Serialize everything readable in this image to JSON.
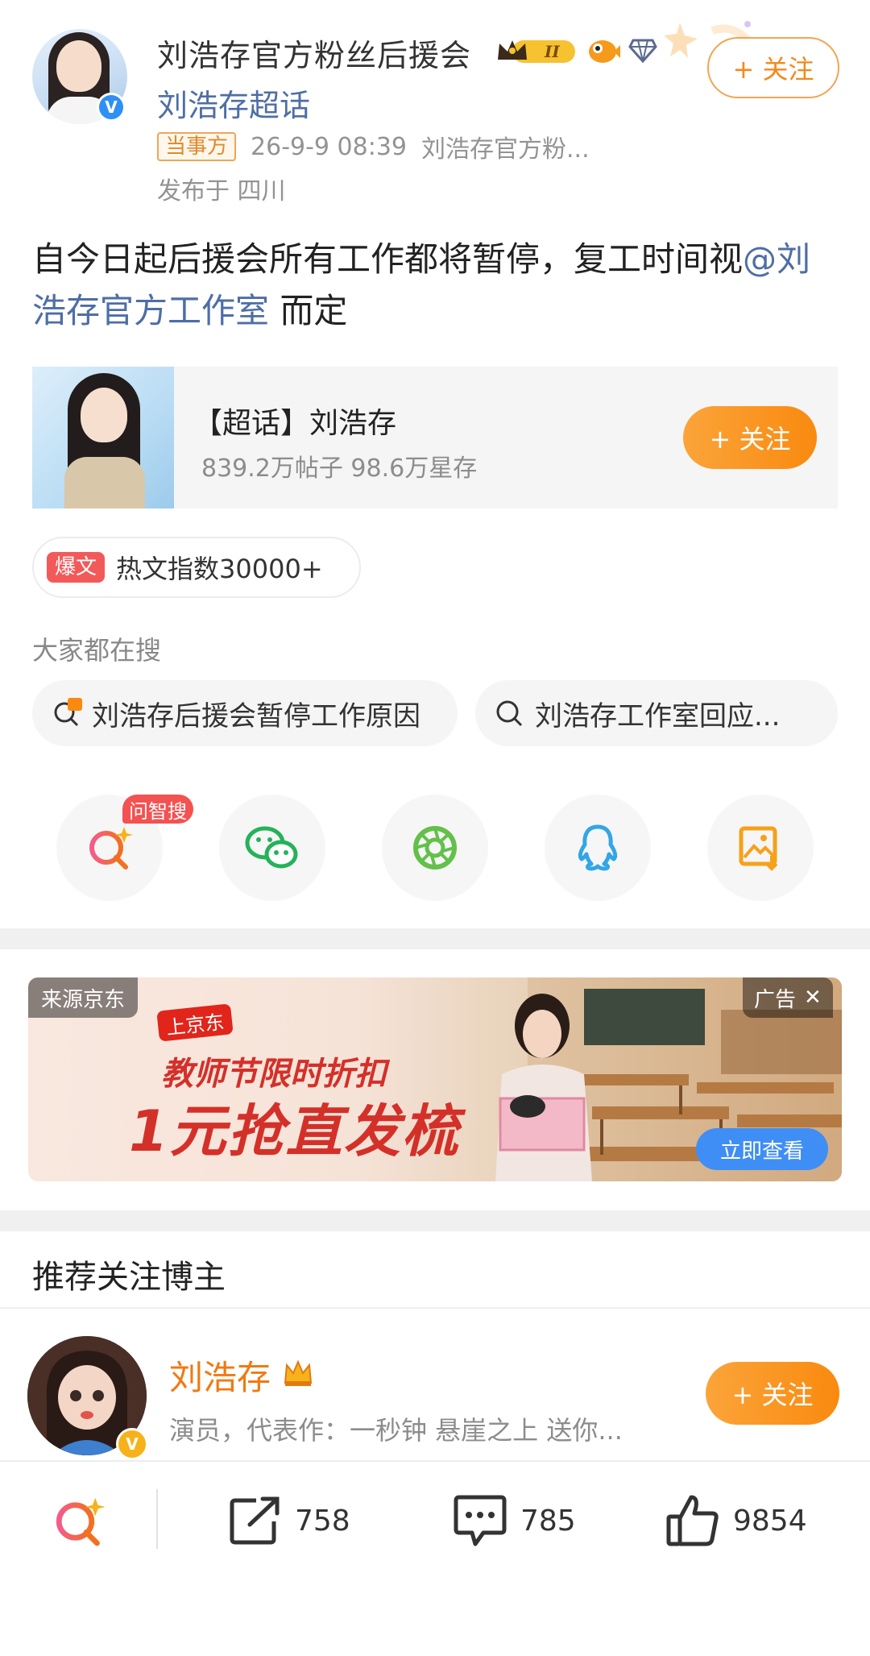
{
  "header": {
    "account_name": "刘浩存官方粉丝后援会",
    "account_subtitle": "刘浩存超话",
    "follow_label": "+ 关注",
    "official_tag": "当事方",
    "time": "26-9-9 08:39",
    "source": "刘浩存官方粉...",
    "location": "发布于 四川",
    "avatar_badge": "V",
    "crown_badge_text": "II"
  },
  "post": {
    "text_before": "自今日起后援会所有工作都将暂停，复工时间视",
    "mention": "@刘浩存官方工作室",
    "text_after": " 而定"
  },
  "topic_card": {
    "name": "【超话】刘浩存",
    "stats": "839.2万帖子  98.6万星存",
    "follow_label": "+ 关注"
  },
  "hot": {
    "tag": "爆文",
    "text": "热文指数30000+"
  },
  "searches": {
    "title": "大家都在搜",
    "items": [
      "刘浩存后援会暂停工作原因",
      "刘浩存工作室回应..."
    ]
  },
  "share": {
    "ask_badge": "问智搜",
    "icons": [
      "ask-search-icon",
      "wechat-icon",
      "moments-icon",
      "qq-icon",
      "save-image-icon"
    ]
  },
  "ad": {
    "source_label": "来源京东",
    "ad_label": "广告",
    "close_glyph": "✕",
    "logo_text": "上京东",
    "headline": "教师节限时折扣",
    "promo": "1元抢直发梳",
    "cta": "立即查看"
  },
  "recommend": {
    "title": "推荐关注博主",
    "name": "刘浩存",
    "desc": "演员，代表作：一秒钟 悬崖之上 送你...",
    "follow_label": "+ 关注",
    "avatar_badge": "V"
  },
  "bottom_bar": {
    "repost_count": "758",
    "comment_count": "785",
    "like_count": "9854"
  },
  "colors": {
    "link_blue": "#4e6ea5",
    "follow_orange": "#f98a0f",
    "hot_red": "#f25a5a",
    "ad_red": "#d4302a"
  }
}
